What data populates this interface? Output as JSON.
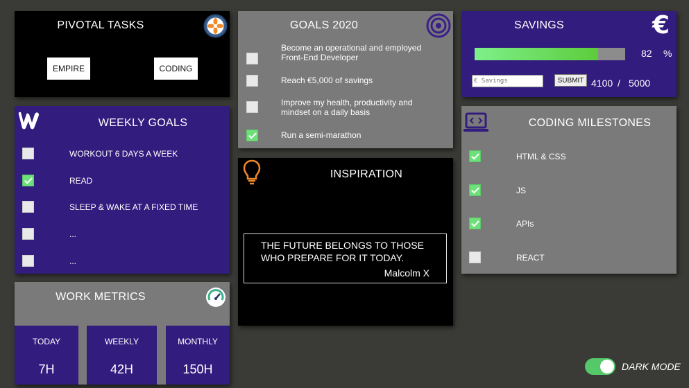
{
  "pivotal": {
    "title": "PIVOTAL TASKS",
    "buttons": [
      "EMPIRE",
      "CODING"
    ]
  },
  "goals": {
    "title": "GOALS 2020",
    "items": [
      {
        "text": "Become an operational and employed Front-End Developer",
        "checked": false
      },
      {
        "text": "Reach €5,000 of savings",
        "checked": false
      },
      {
        "text": "Improve my health, productivity and mindset on a daily basis",
        "checked": false
      },
      {
        "text": "Run a semi-marathon",
        "checked": true
      }
    ]
  },
  "savings": {
    "title": "SAVINGS",
    "icon": "euro-icon",
    "percent": "82",
    "percent_unit": "%",
    "progress": 0.82,
    "input_placeholder": "€ Savings",
    "submit_label": "SUBMIT",
    "current": "4100",
    "separator": "/",
    "target": "5000"
  },
  "weekly": {
    "title": "WEEKLY GOALS",
    "items": [
      {
        "text": "WORKOUT 6 DAYS A WEEK",
        "checked": false
      },
      {
        "text": "READ",
        "checked": true
      },
      {
        "text": "SLEEP & WAKE AT A FIXED TIME",
        "checked": false
      },
      {
        "text": "...",
        "checked": false
      },
      {
        "text": "...",
        "checked": false
      }
    ]
  },
  "inspiration": {
    "title": "INSPIRATION",
    "quote": "THE FUTURE BELONGS TO THOSE WHO PREPARE FOR IT TODAY.",
    "author": "Malcolm X"
  },
  "milestones": {
    "title": "CODING MILESTONES",
    "items": [
      {
        "text": "HTML & CSS",
        "checked": true
      },
      {
        "text": "JS",
        "checked": true
      },
      {
        "text": "APIs",
        "checked": true
      },
      {
        "text": "REACT",
        "checked": false
      }
    ]
  },
  "metrics": {
    "title": "WORK METRICS",
    "items": [
      {
        "label": "TODAY",
        "value": "7H"
      },
      {
        "label": "WEEKLY",
        "value": "42H"
      },
      {
        "label": "MONTHLY",
        "value": "150H"
      }
    ]
  },
  "dark_mode": {
    "label": "DARK MODE",
    "enabled": true
  },
  "colors": {
    "purple": "#321c7e",
    "grey": "#7a7a7a",
    "check_green": "#6ee07a",
    "progress_green": "#5ccc3c",
    "accent_orange": "#f08a2a",
    "toggle_green": "#55c86a"
  }
}
